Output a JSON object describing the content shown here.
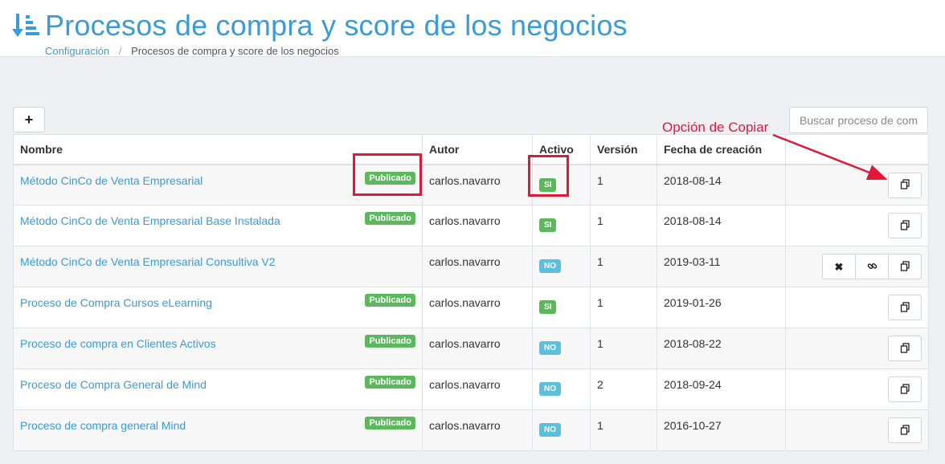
{
  "header": {
    "title": "Procesos de compra y score de los negocios",
    "icon": "sort-amount-down-icon",
    "accent_color": "#3a9bd5"
  },
  "breadcrumb": {
    "items": [
      "Configuración",
      "Procesos de compra y score de los negocios"
    ],
    "separator": "/"
  },
  "toolbar": {
    "add_label": "+",
    "search_placeholder": "Buscar proceso de com"
  },
  "table": {
    "columns": [
      "Nombre",
      "Autor",
      "Activo",
      "Versión",
      "Fecha de creación",
      ""
    ],
    "rows": [
      {
        "name": "Método CinCo de Venta Empresarial",
        "published": "Publicado",
        "author": "carlos.navarro",
        "active": "SI",
        "version": "1",
        "created": "2018-08-14",
        "actions": [
          "copy-icon"
        ]
      },
      {
        "name": "Método CinCo de Venta Empresarial Base Instalada",
        "published": "Publicado",
        "author": "carlos.navarro",
        "active": "SI",
        "version": "1",
        "created": "2018-08-14",
        "actions": [
          "copy-icon"
        ]
      },
      {
        "name": "Método CinCo de Venta Empresarial Consultiva V2",
        "published": "",
        "author": "carlos.navarro",
        "active": "NO",
        "version": "1",
        "created": "2019-03-11",
        "actions": [
          "close-icon",
          "link-icon",
          "copy-icon"
        ]
      },
      {
        "name": "Proceso de Compra Cursos eLearning",
        "published": "Publicado",
        "author": "carlos.navarro",
        "active": "SI",
        "version": "1",
        "created": "2019-01-26",
        "actions": [
          "copy-icon"
        ]
      },
      {
        "name": "Proceso de compra en Clientes Activos",
        "published": "Publicado",
        "author": "carlos.navarro",
        "active": "NO",
        "version": "1",
        "created": "2018-08-22",
        "actions": [
          "copy-icon"
        ]
      },
      {
        "name": "Proceso de Compra General de Mind",
        "published": "Publicado",
        "author": "carlos.navarro",
        "active": "NO",
        "version": "2",
        "created": "2018-09-24",
        "actions": [
          "copy-icon"
        ]
      },
      {
        "name": "Proceso de compra general Mind",
        "published": "Publicado",
        "author": "carlos.navarro",
        "active": "NO",
        "version": "1",
        "created": "2016-10-27",
        "actions": [
          "copy-icon"
        ]
      }
    ]
  },
  "annotation": {
    "label": "Opción de Copiar",
    "color": "#e0193a"
  },
  "colors": {
    "published_badge": "#5cb85c",
    "active_si": "#5cb85c",
    "active_no": "#5bc0de",
    "link": "#3a9bd5"
  }
}
